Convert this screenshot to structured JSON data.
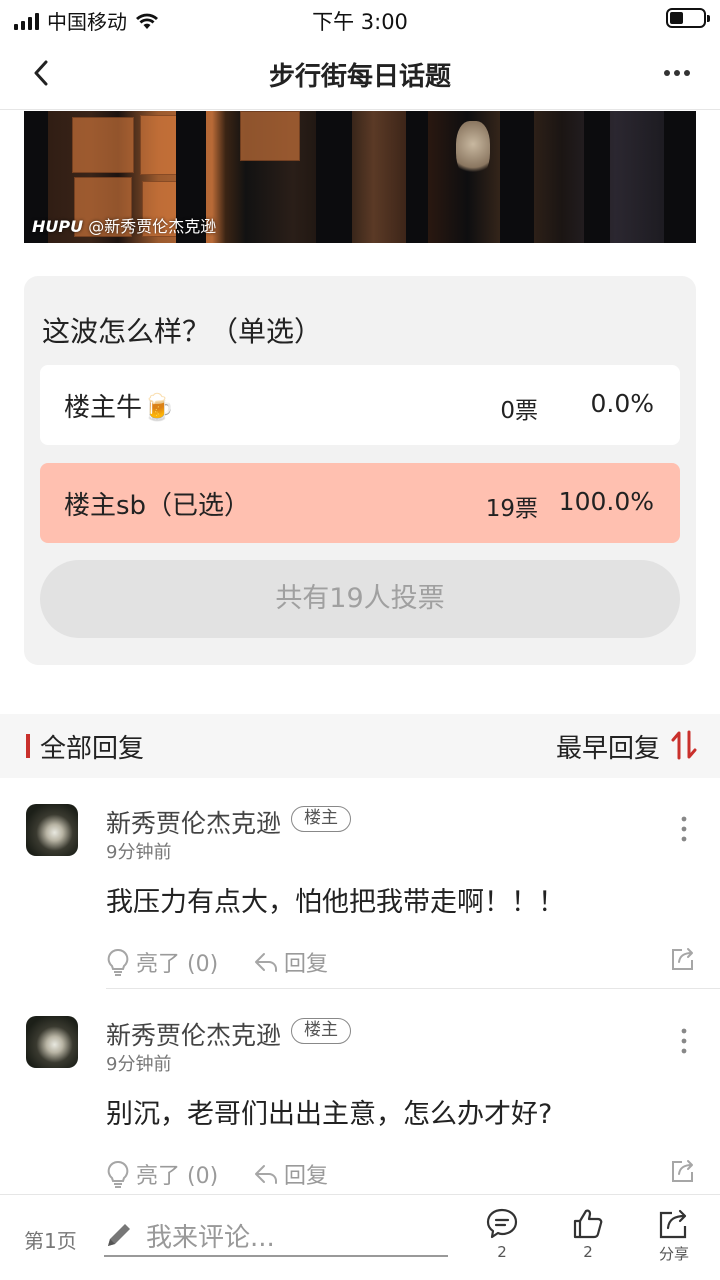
{
  "status_bar": {
    "carrier": "中国移动",
    "time": "下午 3:00"
  },
  "nav": {
    "title": "步行街每日话题"
  },
  "image": {
    "watermark_brand": "HUPU",
    "watermark_user": "@新秀贾伦杰克逊"
  },
  "poll": {
    "question": "这波怎么样？（单选）",
    "options": [
      {
        "label": "楼主牛🍺",
        "votes": "0票",
        "percent": "0.0%",
        "selected": false
      },
      {
        "label": "楼主sb（已选）",
        "votes": "19票",
        "percent": "100.0%",
        "selected": true
      }
    ],
    "total_label": "共有19人投票",
    "selected_color": "#ffc0b0"
  },
  "replies": {
    "title": "全部回复",
    "sort_label": "最早回复",
    "accent_color": "#c9302c"
  },
  "comments": [
    {
      "author": "新秀贾伦杰克逊",
      "badge": "楼主",
      "time": "9分钟前",
      "text": "我压力有点大，怕他把我带走啊！！！",
      "light_label": "亮了 (0)",
      "reply_label": "回复"
    },
    {
      "author": "新秀贾伦杰克逊",
      "badge": "楼主",
      "time": "9分钟前",
      "text": "别沉，老哥们出出主意，怎么办才好?",
      "light_label": "亮了 (0)",
      "reply_label": "回复"
    }
  ],
  "bottom_bar": {
    "page_label": "第1页",
    "comment_placeholder": "我来评论...",
    "comment_count": "2",
    "like_count": "2",
    "share_label": "分享"
  }
}
